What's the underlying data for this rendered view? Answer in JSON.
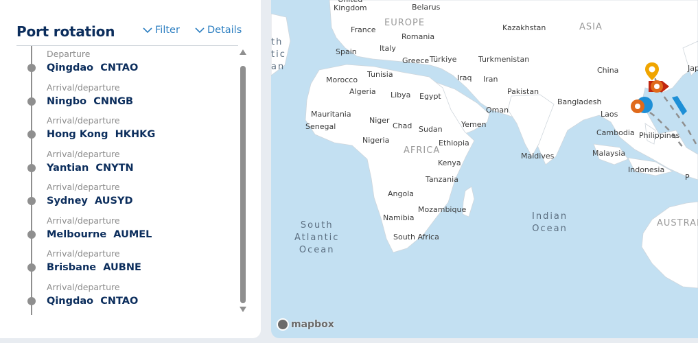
{
  "panel": {
    "title": "Port rotation",
    "filter_label": "Filter",
    "details_label": "Details"
  },
  "ports": [
    {
      "type": "Departure",
      "name": "Qingdao  CNTAO"
    },
    {
      "type": "Arrival/departure",
      "name": "Ningbo  CNNGB"
    },
    {
      "type": "Arrival/departure",
      "name": "Hong Kong  HKHKG"
    },
    {
      "type": "Arrival/departure",
      "name": "Yantian  CNYTN"
    },
    {
      "type": "Arrival/departure",
      "name": "Sydney  AUSYD"
    },
    {
      "type": "Arrival/departure",
      "name": "Melbourne  AUMEL"
    },
    {
      "type": "Arrival/departure",
      "name": "Brisbane  AUBNE"
    },
    {
      "type": "Arrival/departure",
      "name": "Qingdao  CNTAO"
    }
  ],
  "map": {
    "attribution": "mapbox",
    "regions": {
      "europe": "EUROPE",
      "asia": "ASIA",
      "africa": "AFRICA",
      "australia": "AUSTRAL"
    },
    "oceans": {
      "south_atlantic": "South\nAtlantic\nOcean",
      "indian": "Indian\nOcean",
      "north_atlantic": "th\ntic\nan"
    },
    "labels": {
      "united_kingdom": "United\nKingdom",
      "belarus": "Belarus",
      "france": "France",
      "romania": "Romania",
      "kazakhstan": "Kazakhstan",
      "spain": "Spain",
      "italy": "Italy",
      "greece": "Greece",
      "turkiye": "Türkiye",
      "turkmenistan": "Turkmenistan",
      "china": "China",
      "japan": "Jap",
      "tunisia": "Tunisia",
      "morocco": "Morocco",
      "iraq": "Iraq",
      "iran": "Iran",
      "algeria": "Algeria",
      "libya": "Libya",
      "egypt": "Egypt",
      "pakistan": "Pakistan",
      "bangladesh": "Bangladesh",
      "oman": "Oman",
      "laos": "Laos",
      "mauritania": "Mauritania",
      "niger": "Niger",
      "chad": "Chad",
      "sudan": "Sudan",
      "yemen": "Yemen",
      "senegal": "Senegal",
      "nigeria": "Nigeria",
      "ethiopia": "Ethiopia",
      "cambodia": "Cambodia",
      "philippines": "Philippines",
      "malaysia": "Malaysia",
      "maldives": "Maldives",
      "kenya": "Kenya",
      "indonesia": "Indonesia",
      "tanzania": "Tanzania",
      "angola": "Angola",
      "mozambique": "Mozambique",
      "namibia": "Namibia",
      "south_africa": "South Africa",
      "p": "P"
    },
    "colors": {
      "water": "#c3e0f2",
      "land": "#ffffff",
      "route": "#8f8f8f",
      "marker_yellow": "#f0a500",
      "marker_orange": "#e06a1b",
      "marker_red": "#c0260f",
      "marker_blue": "#1e8fd6"
    }
  }
}
